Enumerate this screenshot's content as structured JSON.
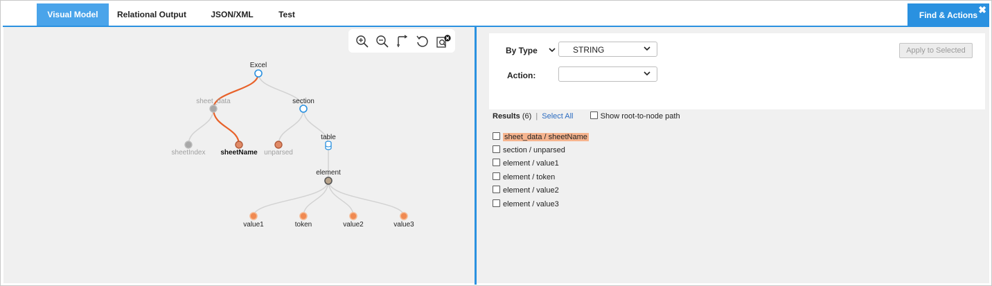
{
  "tabs": [
    {
      "label": "Visual Model",
      "active": true
    },
    {
      "label": "Relational Output",
      "active": false
    },
    {
      "label": "JSON/XML",
      "active": false
    },
    {
      "label": "Test",
      "active": false
    }
  ],
  "find_panel": {
    "title": "Find & Actions",
    "close": "✖"
  },
  "toolbar": [
    "zoom-in",
    "zoom-out",
    "fit-layout",
    "reset",
    "close-search"
  ],
  "tree": {
    "nodes": {
      "excel": "Excel",
      "sheet_data": "sheet_data",
      "section": "section",
      "sheetIndex": "sheetIndex",
      "sheetName": "sheetName",
      "unparsed": "unparsed",
      "table": "table",
      "element": "element",
      "value1": "value1",
      "token": "token",
      "value2": "value2",
      "value3": "value3"
    },
    "colors": {
      "highlight_path": "#e8622a",
      "link": "#d2d2d2",
      "node_blue": "#2a91e0",
      "node_gray": "#a8a8a8",
      "node_orange": "#f08a52"
    }
  },
  "filter": {
    "by_type_label": "By Type",
    "type_value": "STRING",
    "action_label": "Action:",
    "action_value": "",
    "apply_label": "Apply to Selected"
  },
  "results": {
    "label": "Results",
    "count": "(6)",
    "separator": "|",
    "select_all": "Select All",
    "show_path": "Show root-to-node path",
    "items": [
      {
        "text": "sheet_data / sheetName",
        "highlighted": true
      },
      {
        "text": "section / unparsed",
        "highlighted": false
      },
      {
        "text": "element / value1",
        "highlighted": false
      },
      {
        "text": "element / token",
        "highlighted": false
      },
      {
        "text": "element / value2",
        "highlighted": false
      },
      {
        "text": "element / value3",
        "highlighted": false
      }
    ]
  }
}
